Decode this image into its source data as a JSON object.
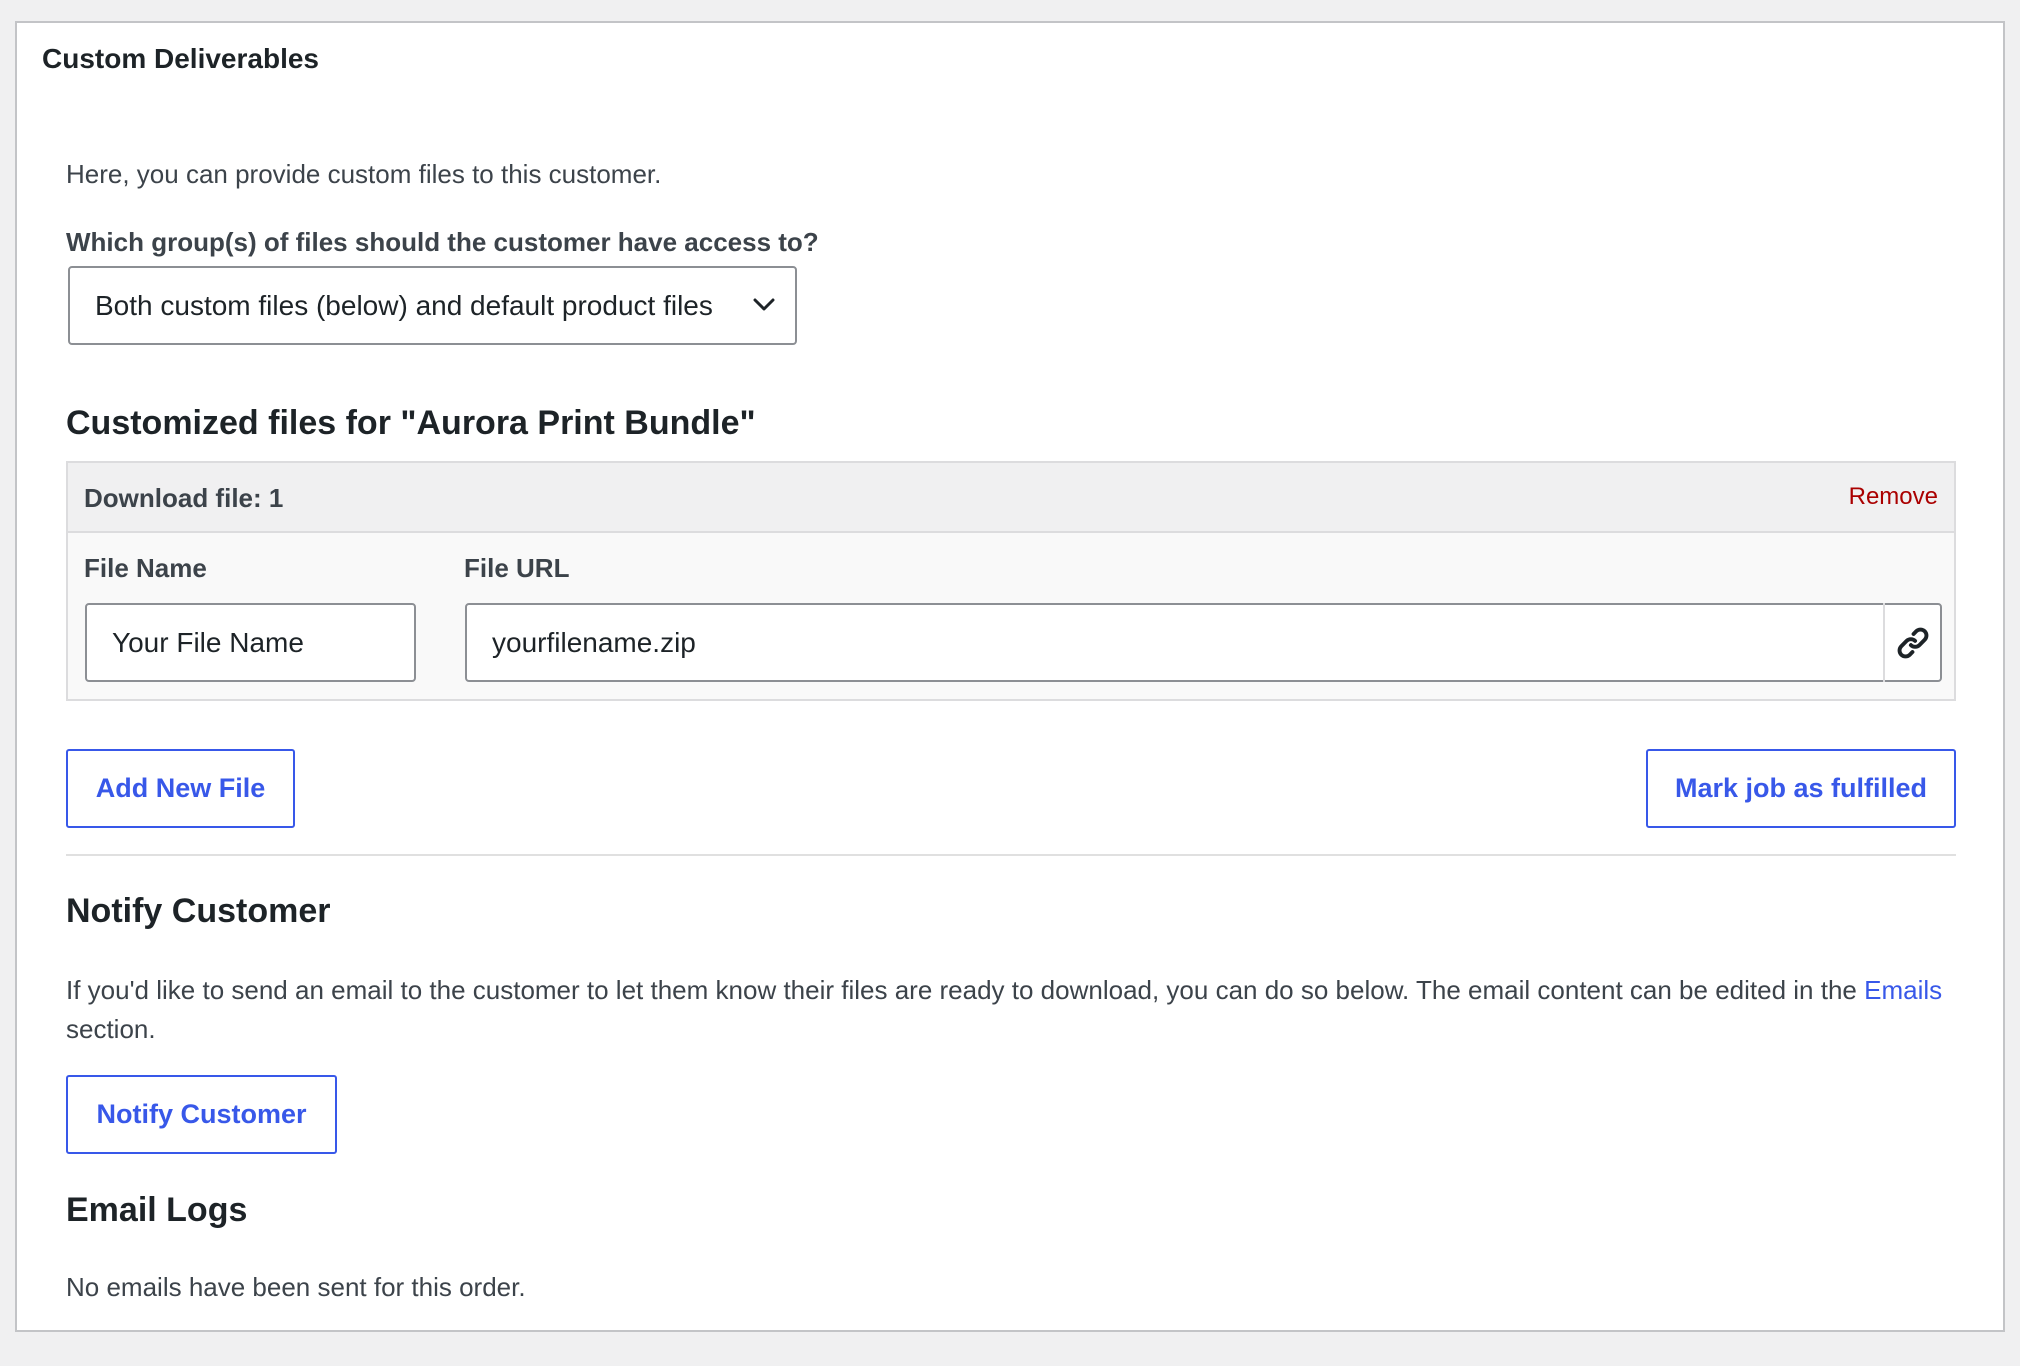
{
  "panel": {
    "title": "Custom Deliverables"
  },
  "intro": "Here, you can provide custom files to this customer.",
  "access": {
    "label": "Which group(s) of files should the customer have access to?",
    "selected": "Both custom files (below) and default product files"
  },
  "custom_files": {
    "title": "Customized files for \"Aurora Print Bundle\"",
    "file": {
      "header": "Download file: 1",
      "remove_label": "Remove",
      "name_label": "File Name",
      "name_value": "Your File Name",
      "url_label": "File URL",
      "url_value": "yourfilename.zip"
    },
    "add_button": "Add New File",
    "fulfill_button": "Mark job as fulfilled"
  },
  "notify": {
    "title": "Notify Customer",
    "text_before": "If you'd like to send an email to the customer to let them know their files are ready to download, you can do so below. The email content can be edited in the",
    "link_text": "Emails",
    "text_after": " section.",
    "button": "Notify Customer"
  },
  "logs": {
    "title": "Email Logs",
    "empty_text": "No emails have been sent for this order."
  },
  "colors": {
    "accent": "#3858e9",
    "danger": "#aa0000",
    "border": "#8c8f94"
  }
}
